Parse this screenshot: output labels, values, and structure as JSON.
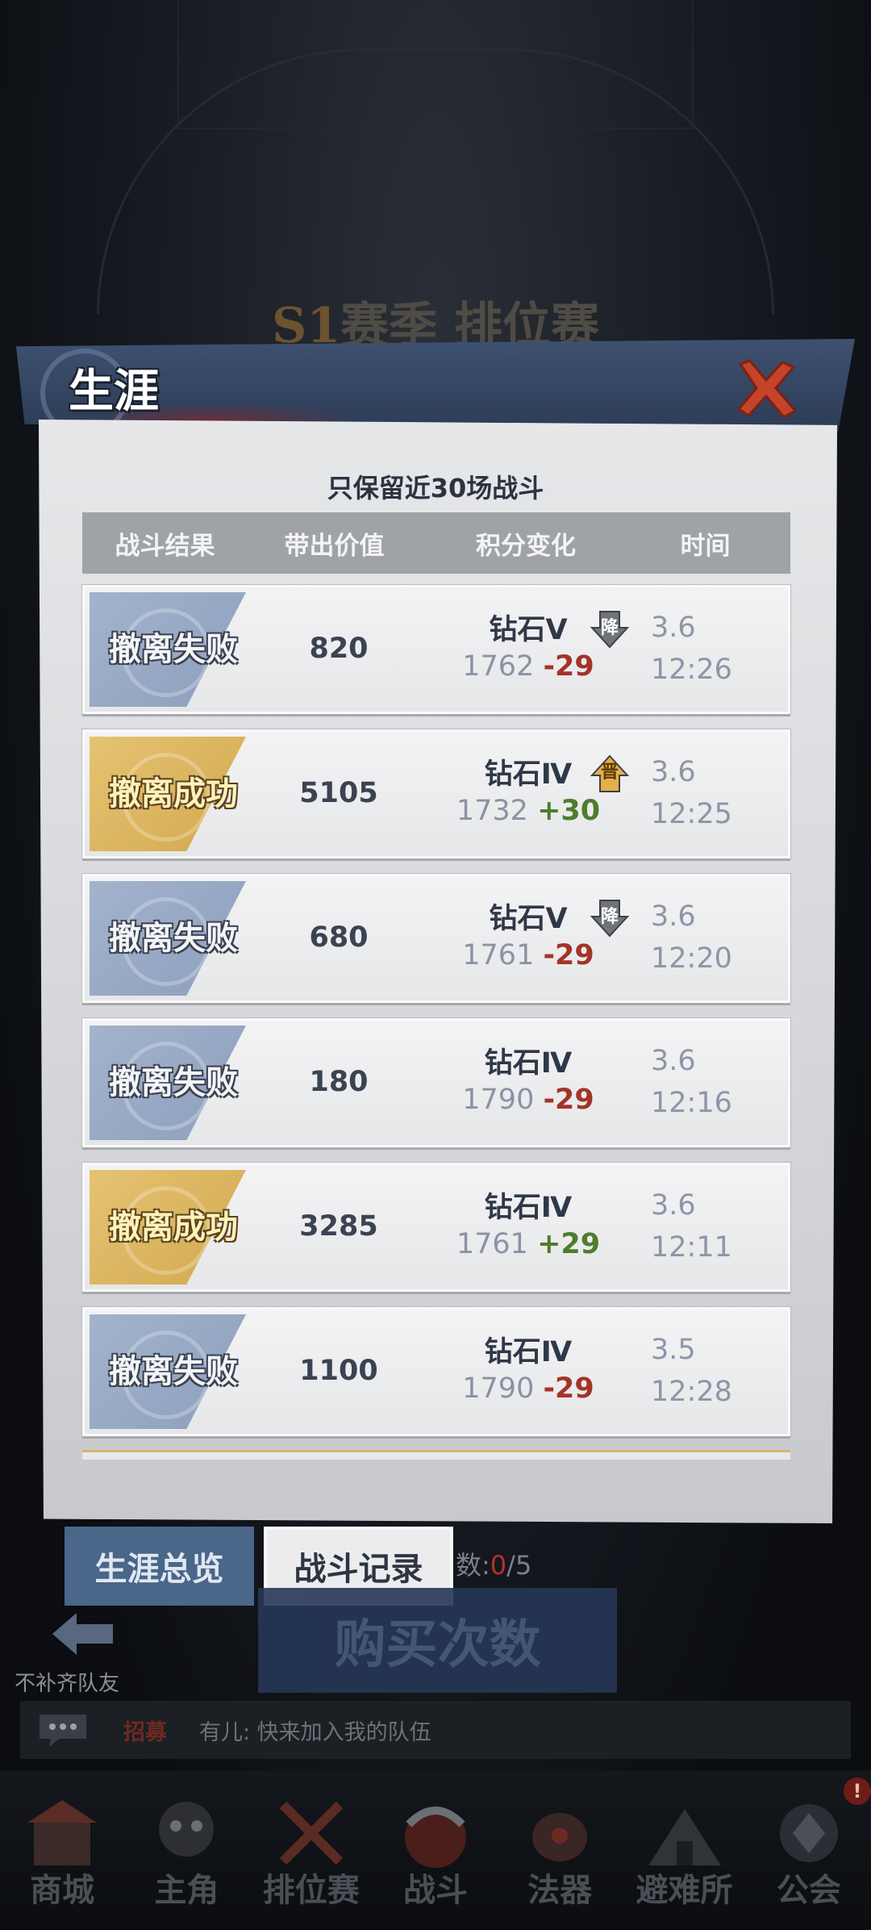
{
  "background": {
    "season_prefix": "S1",
    "season_title": "赛季 排位赛"
  },
  "panel": {
    "title": "生涯",
    "subtitle": "只保留近30场战斗",
    "columns": [
      "战斗结果",
      "带出价值",
      "积分变化",
      "时间"
    ],
    "rows": [
      {
        "result": "撤离失败",
        "status": "fail",
        "value": "820",
        "rank": "钻石Ⅴ",
        "score": "1762",
        "delta": "-29",
        "arrow": "降",
        "arrow_dir": "down",
        "date": "3.6",
        "time": "12:26"
      },
      {
        "result": "撤离成功",
        "status": "success",
        "value": "5105",
        "rank": "钻石Ⅳ",
        "score": "1732",
        "delta": "+30",
        "arrow": "晋",
        "arrow_dir": "up",
        "date": "3.6",
        "time": "12:25"
      },
      {
        "result": "撤离失败",
        "status": "fail",
        "value": "680",
        "rank": "钻石Ⅴ",
        "score": "1761",
        "delta": "-29",
        "arrow": "降",
        "arrow_dir": "down",
        "date": "3.6",
        "time": "12:20"
      },
      {
        "result": "撤离失败",
        "status": "fail",
        "value": "180",
        "rank": "钻石Ⅳ",
        "score": "1790",
        "delta": "-29",
        "arrow": "",
        "arrow_dir": "",
        "date": "3.6",
        "time": "12:16"
      },
      {
        "result": "撤离成功",
        "status": "success",
        "value": "3285",
        "rank": "钻石Ⅳ",
        "score": "1761",
        "delta": "+29",
        "arrow": "",
        "arrow_dir": "",
        "date": "3.6",
        "time": "12:11"
      },
      {
        "result": "撤离失败",
        "status": "fail",
        "value": "1100",
        "rank": "钻石Ⅳ",
        "score": "1790",
        "delta": "-29",
        "arrow": "",
        "arrow_dir": "",
        "date": "3.5",
        "time": "12:28"
      }
    ],
    "close_icon": "close-x-icon"
  },
  "tabs": {
    "overview": "生涯总览",
    "records": "战斗记录",
    "active": "records"
  },
  "attempts": {
    "label_suffix": "数:",
    "current": "0",
    "max": "/5"
  },
  "buy_button": "购买次数",
  "no_fill_label": "不补齐队友",
  "chat": {
    "tag": "招募",
    "message": "有儿: 快来加入我的队伍"
  },
  "nav": [
    {
      "label": "商城",
      "icon": "shop-icon"
    },
    {
      "label": "主角",
      "icon": "hero-icon"
    },
    {
      "label": "排位赛",
      "icon": "ranked-icon"
    },
    {
      "label": "战斗",
      "icon": "battle-icon"
    },
    {
      "label": "法器",
      "icon": "artifact-icon"
    },
    {
      "label": "避难所",
      "icon": "shelter-icon"
    },
    {
      "label": "公会",
      "icon": "guild-icon",
      "badge": "!"
    }
  ],
  "colors": {
    "fail_badge": "#8c9fbc",
    "success_badge": "#d2a84f",
    "negative_delta": "#a43328",
    "positive_delta": "#4e7d2e",
    "header_blue": "#3e5170",
    "close_red": "#c4432a"
  }
}
